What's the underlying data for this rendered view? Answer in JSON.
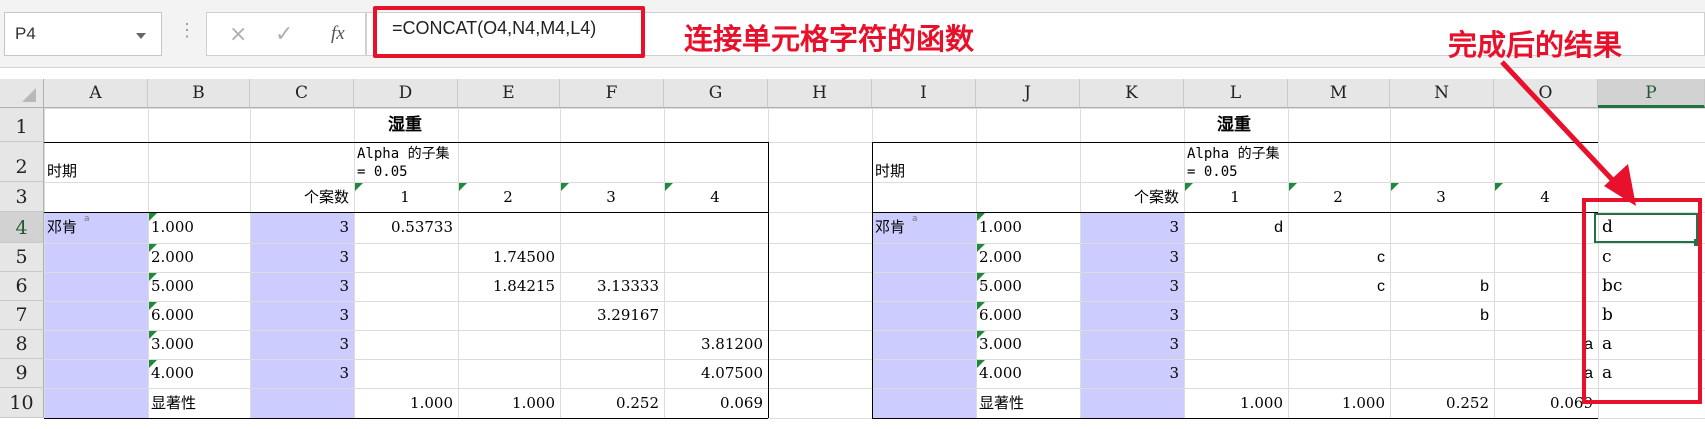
{
  "name_box": "P4",
  "formula_bar": {
    "cancel_icon": "×",
    "enter_icon": "✓",
    "fx_icon": "fx",
    "formula": "=CONCAT(O4,N4,M4,L4)"
  },
  "annotations": {
    "func_label": "连接单元格字符的函数",
    "result_label": "完成后的结果"
  },
  "columns": [
    "A",
    "B",
    "C",
    "D",
    "E",
    "F",
    "G",
    "H",
    "I",
    "J",
    "K",
    "L",
    "M",
    "N",
    "O",
    "P"
  ],
  "rows": [
    "1",
    "2",
    "3",
    "4",
    "5",
    "6",
    "7",
    "8",
    "9",
    "10"
  ],
  "left_table": {
    "title": "湿重",
    "period_label": "时期",
    "subset_label": "Alpha 的子集 = 0.05",
    "n_label": "个案数",
    "subset_cols": [
      "1",
      "2",
      "3",
      "4"
    ],
    "group_label": "邓肯",
    "group_mark": "a",
    "periods": [
      "1.000",
      "2.000",
      "5.000",
      "6.000",
      "3.000",
      "4.000"
    ],
    "counts": [
      "3",
      "3",
      "3",
      "3",
      "3",
      "3"
    ],
    "d_vals": [
      "0.53733",
      "",
      "",
      "",
      "",
      ""
    ],
    "e_vals": [
      "",
      "1.74500",
      "1.84215",
      "",
      "",
      ""
    ],
    "f_vals": [
      "",
      "",
      "3.13333",
      "3.29167",
      "",
      ""
    ],
    "g_vals": [
      "",
      "",
      "",
      "",
      "3.81200",
      "4.07500"
    ],
    "sig_label": "显著性",
    "sig_vals": [
      "1.000",
      "1.000",
      "0.252",
      "0.069"
    ]
  },
  "right_table": {
    "title": "湿重",
    "period_label": "时期",
    "subset_label": "Alpha 的子集 = 0.05",
    "n_label": "个案数",
    "subset_cols": [
      "1",
      "2",
      "3",
      "4"
    ],
    "group_label": "邓肯",
    "group_mark": "a",
    "periods": [
      "1.000",
      "2.000",
      "5.000",
      "6.000",
      "3.000",
      "4.000"
    ],
    "counts": [
      "3",
      "3",
      "3",
      "3",
      "3",
      "3"
    ],
    "l_vals": [
      "d",
      "",
      "",
      "",
      "",
      ""
    ],
    "m_vals": [
      "",
      "c",
      "c",
      "",
      "",
      ""
    ],
    "n_vals": [
      "",
      "",
      "b",
      "b",
      "",
      ""
    ],
    "o_vals": [
      "",
      "",
      "",
      "",
      "a",
      "a"
    ],
    "sig_label": "显著性",
    "sig_vals": [
      "1.000",
      "1.000",
      "0.252",
      "0.069"
    ]
  },
  "result_col": [
    "d",
    "c",
    "bc",
    "b",
    "a",
    "a"
  ],
  "colors": {
    "accent_red": "#e8102a",
    "excel_green": "#217346",
    "group_fill": "#ccccff"
  }
}
